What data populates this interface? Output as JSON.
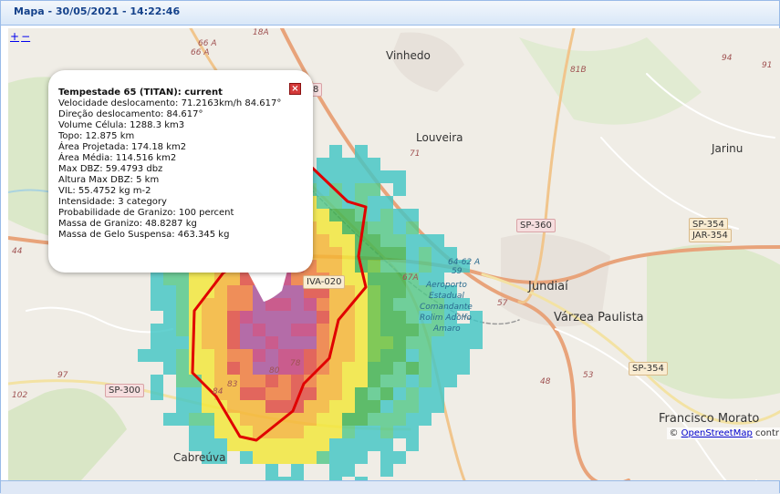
{
  "window": {
    "title": "Mapa - 30/05/2021 - 14:22:46"
  },
  "zoom": {
    "plus": "+",
    "minus": "−"
  },
  "popup": {
    "title": "Tempestade 65 (TITAN): current",
    "lines": [
      "Velocidade deslocamento: 71.2163km/h 84.617°",
      "Direção deslocamento: 84.617°",
      "Volume Célula: 1288.3 km3",
      "Topo: 12.875 km",
      "Área Projetada: 174.18 km2",
      "Área Média: 114.516 km2",
      "Max DBZ: 59.4793 dbz",
      "Altura Max DBZ: 5 km",
      "VIL: 55.4752 kg m-2",
      "Intensidade: 3 category",
      "Probabilidade de Granizo: 100 percent",
      "Massa de Granizo: 48.8287 kg",
      "Massa de Gelo Suspensa: 463.345 kg"
    ],
    "close_icon": "close-icon"
  },
  "attribution": {
    "prefix": "©",
    "link": "OpenStreetMap",
    "suffix": " contr"
  },
  "map_labels": {
    "towns": [
      "Vinhedo",
      "Louveira",
      "Jarinu",
      "Jundiaí",
      "Várzea Paulista",
      "Francisco Morato",
      "Cabreúva"
    ],
    "airport": [
      "Aeroporto",
      "Estadual",
      "Comandante",
      "Rolim Adolfo",
      "Amaro"
    ],
    "shields": [
      "SP-360",
      "SP-354",
      "JAR-354",
      "SP-354",
      "SP-300",
      "IVA-020",
      "8"
    ],
    "roads": [
      "66 A",
      "66 A",
      "18A",
      "81B",
      "94",
      "91",
      "71",
      "44",
      "97",
      "102",
      "67A",
      "64-62 A",
      "59",
      "57",
      "48",
      "53",
      "78",
      "80",
      "83",
      "84"
    ]
  }
}
